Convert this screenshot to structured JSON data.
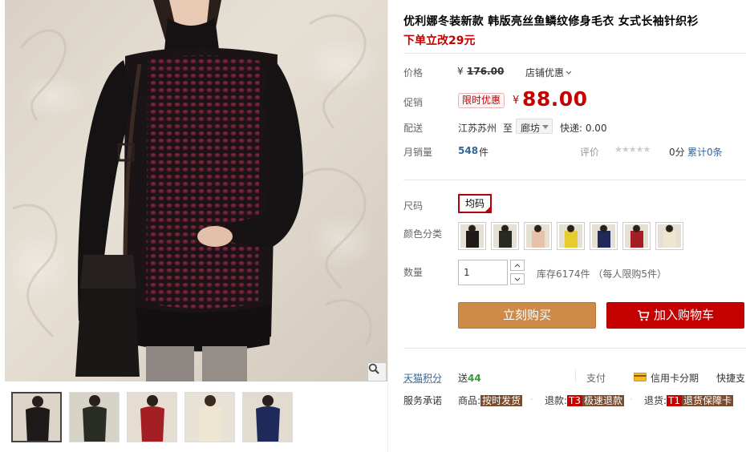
{
  "product": {
    "title": "优利娜冬装新款 韩版亮丝鱼鳞纹修身毛衣 女式长袖针织衫",
    "subtitle": "下单立改29元"
  },
  "price": {
    "label": "价格",
    "currency": "¥",
    "original": "176.00",
    "shop_promo": "店铺优惠"
  },
  "promo": {
    "label": "促销",
    "badge": "限时优惠",
    "currency": "¥",
    "price": "88.00"
  },
  "shipping": {
    "label": "配送",
    "from": "江苏苏州",
    "to_word": "至",
    "destination": "廊坊",
    "fee": "快递: 0.00"
  },
  "sales": {
    "label": "月销量",
    "count": "548",
    "unit": "件",
    "rating_label": "评价",
    "stars": "★★★★★",
    "score": "0分",
    "total": "累计0条"
  },
  "size": {
    "label": "尺码",
    "options": [
      "均码"
    ],
    "selected": "均码"
  },
  "color": {
    "label": "颜色分类",
    "swatches": [
      "#1f1a1a",
      "#2a2a24",
      "#e8c2a8",
      "#e6cc2e",
      "#1f2a5a",
      "#a31f24",
      "#efe6d2"
    ]
  },
  "quantity": {
    "label": "数量",
    "value": "1",
    "stock": "库存6174件 （每人限购5件）"
  },
  "actions": {
    "buy_now": "立刻购买",
    "add_cart": "加入购物车"
  },
  "footer": {
    "points_label": "天猫积分",
    "points_prefix": "送",
    "points_value": "44",
    "pay_label": "支付",
    "credit": "信用卡分期",
    "fast_pay": "快捷支",
    "service_label": "服务承诺",
    "goods_label": "商品:",
    "goods_tag": "按时发货",
    "refund_label": "退款:",
    "refund_code": "T3",
    "refund_tag": "极速退款",
    "return_label": "退货:",
    "return_code": "T1",
    "return_tag": "退货保障卡"
  },
  "gallery": {
    "thumb_colors": [
      "#1f1a1a",
      "#2a2d26",
      "#a31f24",
      "#efe6d2",
      "#1f2a5a"
    ],
    "active_index": 0
  }
}
